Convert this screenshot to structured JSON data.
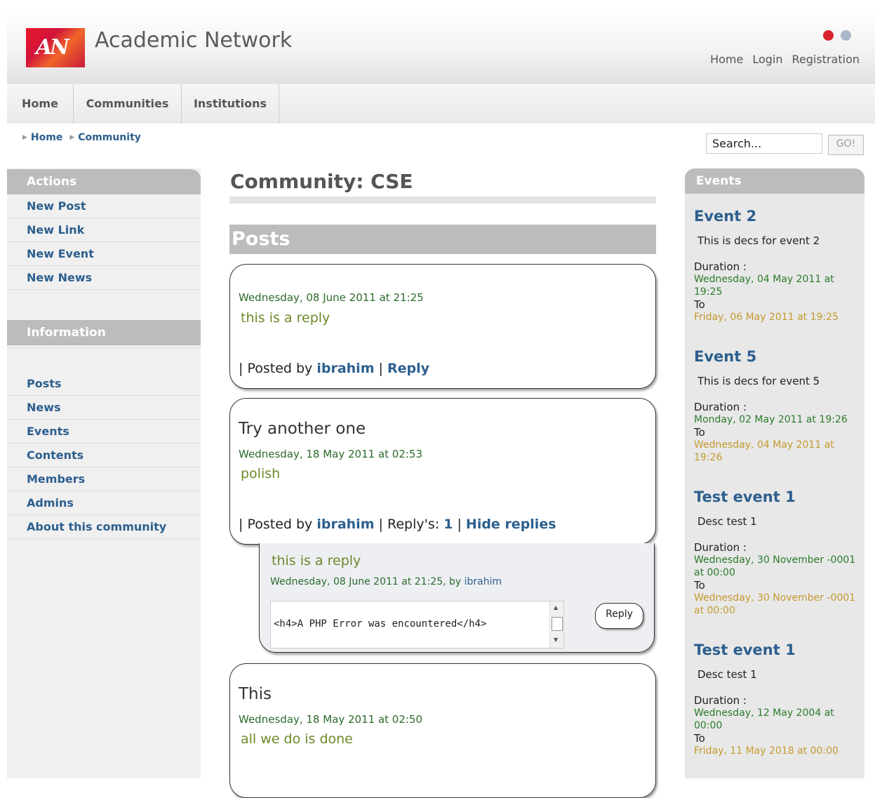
{
  "header": {
    "logo_text": "AN",
    "site_title": "Academic Network",
    "top_links": [
      "Home",
      "Login",
      "Registration"
    ]
  },
  "nav": {
    "tabs": [
      "Home",
      "Communities",
      "Institutions"
    ]
  },
  "breadcrumb": [
    "Home",
    "Community"
  ],
  "search": {
    "placeholder": "Search...",
    "value": "Search...",
    "button": "GO!"
  },
  "sidebar": {
    "actions_title": "Actions",
    "actions": [
      "New Post",
      "New Link",
      "New Event",
      "New News"
    ],
    "info_title": "Information",
    "info_items": [
      "Posts",
      "News",
      "Events",
      "Contents",
      "Members",
      "Admins",
      "About this community"
    ]
  },
  "main": {
    "page_title": "Community: CSE",
    "posts_title": "Posts",
    "posts": [
      {
        "title": "",
        "date": "Wednesday, 08 June 2011 at 21:25",
        "body": "this is a reply",
        "meta_prefix": "| Posted by",
        "author": "ibrahim",
        "sep": "|",
        "action": "Reply"
      },
      {
        "title": "Try another one",
        "date": "Wednesday, 18 May 2011 at 02:53",
        "body": "polish",
        "meta_prefix": "| Posted by",
        "author": "ibrahim",
        "replies_label": "| Reply's:",
        "replies_count": "1",
        "sep": "|",
        "action": "Hide replies"
      },
      {
        "title": "This",
        "date": "Wednesday, 18 May 2011 at 02:50",
        "body": "all we do is done"
      }
    ],
    "reply": {
      "text": "this is a reply",
      "meta": "Wednesday, 08 June 2011 at 21:25, by",
      "author": "ibrahim",
      "textarea_value": "<h4>A PHP Error was encountered</h4>",
      "button": "Reply"
    }
  },
  "events": {
    "title": "Events",
    "duration_label": "Duration :",
    "to_label": "To",
    "items": [
      {
        "name": "Event 2",
        "desc": "This is decs for event 2",
        "start": "Wednesday, 04 May 2011 at 19:25",
        "end": "Friday, 06 May 2011 at 19:25"
      },
      {
        "name": "Event 5",
        "desc": "This is decs for event 5",
        "start": "Monday, 02 May 2011 at 19:26",
        "end": "Wednesday, 04 May 2011 at 19:26"
      },
      {
        "name": "Test event 1",
        "desc": "Desc test 1",
        "start": "Wednesday, 30 November -0001 at 00:00",
        "end": "Wednesday, 30 November -0001 at 00:00"
      },
      {
        "name": "Test event 1",
        "desc": "Desc test 1",
        "start": "Wednesday, 12 May 2004 at 00:00",
        "end": "Friday, 11 May 2018 at 00:00"
      }
    ]
  }
}
